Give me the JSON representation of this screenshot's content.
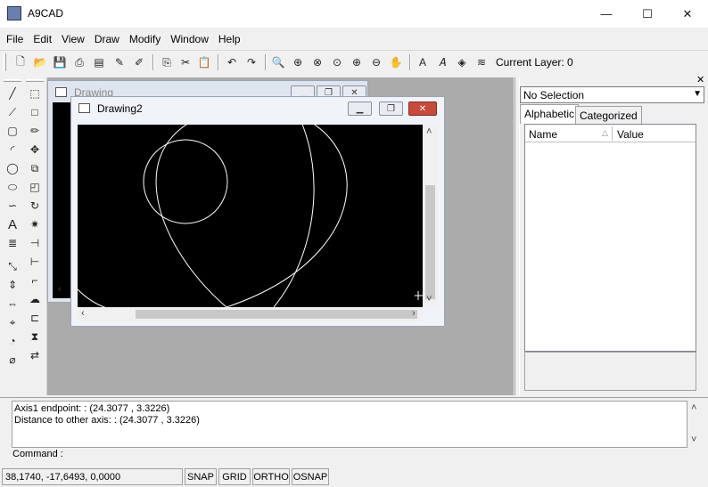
{
  "window": {
    "title": "A9CAD"
  },
  "window_controls": {
    "minimize": "—",
    "maximize": "☐",
    "close": "✕"
  },
  "menu": [
    "File",
    "Edit",
    "View",
    "Draw",
    "Modify",
    "Window",
    "Help"
  ],
  "toolbar": {
    "buttons": [
      "new-icon",
      "open-icon",
      "save-icon",
      "print-icon",
      "print-preview-icon",
      "pen-icon",
      "pen-tool-icon",
      "copy-icon",
      "cut-icon",
      "paste-icon",
      "undo-icon",
      "redo-icon",
      "zoom-extents-icon",
      "zoom-window-icon",
      "zoom-all-icon",
      "zoom-previous-icon",
      "zoom-in-icon",
      "zoom-out-icon",
      "pan-icon",
      "text-style-icon",
      "text-edit-icon",
      "layer-props-icon",
      "layers-icon"
    ],
    "current_layer_label": "Current Layer: 0"
  },
  "left_toolbar_draw": [
    "line-icon",
    "polyline-icon",
    "rectangle-icon",
    "arc-icon",
    "circle-icon",
    "ellipse-icon",
    "spline-icon",
    "text-icon",
    "hatch-icon",
    "dimension-linear-icon",
    "dimension-vertical-icon",
    "dimension-aligned-icon",
    "dimension-angle-icon",
    "dimension-radius-icon",
    "dimension-diameter-icon"
  ],
  "left_toolbar_modify": [
    "select-icon",
    "erase-icon",
    "properties-icon",
    "move-icon",
    "copy-object-icon",
    "scale-icon",
    "rotate-icon",
    "explode-icon",
    "trim-icon",
    "extend-icon",
    "fillet-icon",
    "cloud-icon",
    "stretch-icon",
    "mirror-icon",
    "array-icon"
  ],
  "drawings": {
    "back": {
      "title": "Drawing"
    },
    "front": {
      "title": "Drawing2"
    }
  },
  "properties": {
    "selection": "No Selection",
    "tabs": [
      "Alphabetic",
      "Categorized"
    ],
    "columns": [
      "Name",
      "Value"
    ]
  },
  "command": {
    "lines": [
      "Axis1 endpoint: : (24.3077 , 3.3226)",
      "Distance to other axis: : (24.3077 , 3.3226)"
    ],
    "prompt": "Command :"
  },
  "status": {
    "coords": "38,1740, -17,6493, 0,0000",
    "toggles": [
      "SNAP",
      "GRID",
      "ORTHO",
      "OSNAP"
    ]
  }
}
